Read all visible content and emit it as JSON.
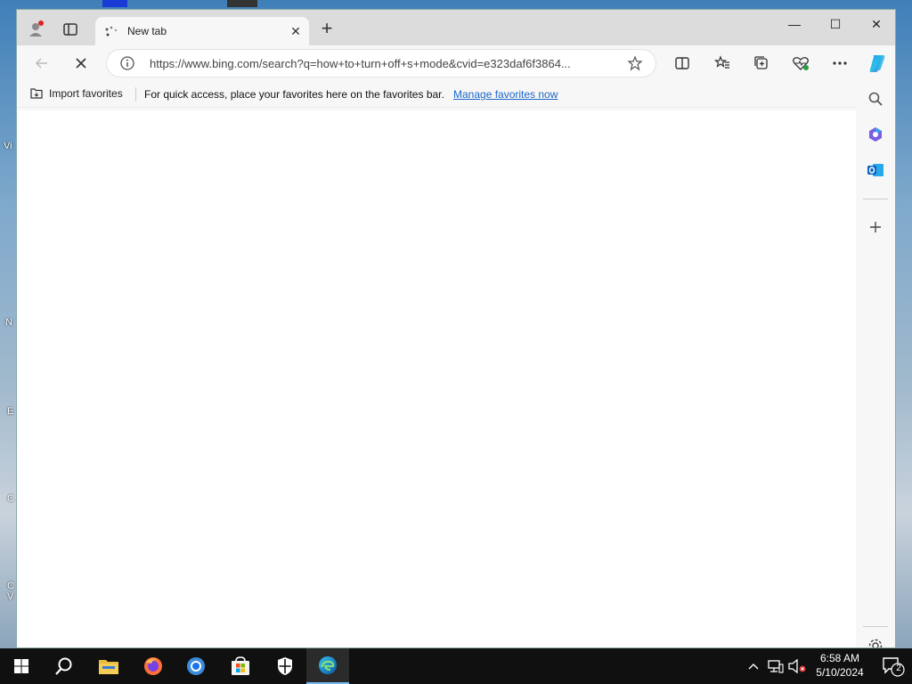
{
  "desktop": {
    "edge_labels": [
      "Vi",
      "N",
      "E",
      "C",
      "C\nV"
    ]
  },
  "browser": {
    "tab": {
      "title": "New tab",
      "close_glyph": "✕"
    },
    "new_tab_glyph": "+",
    "window_controls": {
      "minimize": "—",
      "maximize": "☐",
      "close": "✕"
    },
    "address_bar": {
      "url": "https://www.bing.com/search?q=how+to+turn+off+s+mode&cvid=e323daf6f3864..."
    },
    "favorites_bar": {
      "import_label": "Import favorites",
      "message": "For quick access, place your favorites here on the favorites bar.",
      "manage_link": "Manage favorites now"
    },
    "toolbar_icons": [
      "back-icon",
      "stop-loading-icon",
      "split-screen-icon",
      "favorites-icon",
      "collections-icon",
      "browser-essentials-icon",
      "more-icon",
      "copilot-icon"
    ],
    "sidebar_icons": [
      "search-icon",
      "copilot-discover-icon",
      "outlook-icon",
      "add-icon",
      "settings-icon"
    ]
  },
  "taskbar": {
    "apps": [
      "start-icon",
      "search-icon",
      "file-explorer-icon",
      "firefox-icon",
      "chrome-icon",
      "microsoft-store-icon",
      "windows-security-icon",
      "edge-icon"
    ],
    "clock": {
      "time": "6:58 AM",
      "date": "5/10/2024"
    },
    "notification_count": "2"
  },
  "colors": {
    "accent": "#1a66c9",
    "taskbar": "#101010",
    "edge_active": "#76b9ed"
  }
}
